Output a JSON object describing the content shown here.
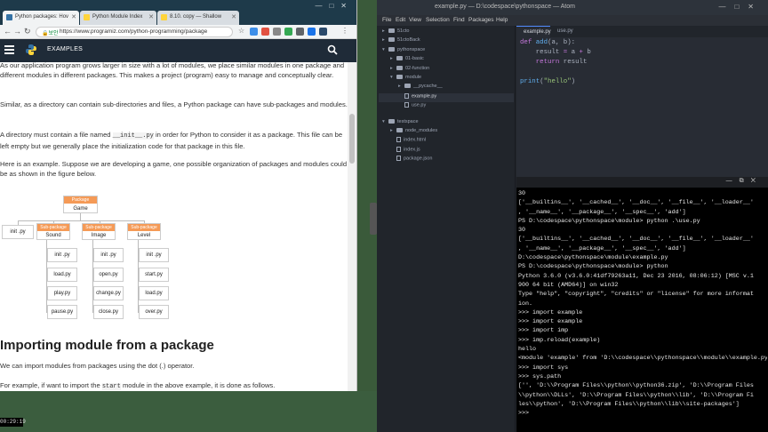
{
  "chrome": {
    "tabs": [
      {
        "label": "Python packages: Hov"
      },
      {
        "label": "Python Module Index"
      },
      {
        "label": "8.10. copy — Shallow"
      }
    ],
    "url_secure": "보안",
    "url": "https://www.programiz.com/python-programming/package",
    "site": {
      "nav_label": "EXAMPLES"
    },
    "content": {
      "p1": "As our application program grows larger in size with a lot of modules, we place similar modules in one package and different modules in different packages. This makes a project (program) easy to manage and conceptually clear.",
      "p2": "Similar, as a directory can contain sub-directories and files, a Python package can have sub-packages and modules.",
      "p3_a": "A directory must contain a file named",
      "p3_code": "__init__.py",
      "p3_b": "in order for Python to consider it as a package. This file can be left empty but we generally place the initialization code for that package in this file.",
      "p4": "Here is an example. Suppose we are developing a game, one possible organization of packages and modules could be as shown in the figure below.",
      "heading": "Importing module from a package",
      "p5": "We can import modules from packages using the dot (.) operator.",
      "p6_a": "For example, if want to import the",
      "p6_code": "start",
      "p6_b": "module in the above example, it is done as follows."
    },
    "diagram": {
      "package_tag": "Package",
      "package_name": "Game",
      "subpackage_tag": "Sub-package",
      "root_init": "init  .py",
      "subpackages": [
        {
          "name": "Sound",
          "files": [
            "init  .py",
            "load.py",
            "play.py",
            "pause.py"
          ]
        },
        {
          "name": "Image",
          "files": [
            "init  .py",
            "open.py",
            "change.py",
            "close.py"
          ]
        },
        {
          "name": "Level",
          "files": [
            "init  .py",
            "start.py",
            "load.py",
            "over.py"
          ]
        }
      ]
    }
  },
  "atom": {
    "title": "example.py — D:\\codespace\\pythonspace — Atom",
    "menu": [
      "File",
      "Edit",
      "View",
      "Selection",
      "Find",
      "Packages",
      "Help"
    ],
    "tree": [
      {
        "label": "51cto",
        "depth": 0,
        "type": "folder",
        "open": false
      },
      {
        "label": "51ctoBack",
        "depth": 0,
        "type": "folder",
        "open": false
      },
      {
        "label": "pythonspace",
        "depth": 0,
        "type": "folder",
        "open": true
      },
      {
        "label": "01-basic",
        "depth": 1,
        "type": "folder",
        "open": false
      },
      {
        "label": "02-function",
        "depth": 1,
        "type": "folder",
        "open": false
      },
      {
        "label": "module",
        "depth": 1,
        "type": "folder",
        "open": true
      },
      {
        "label": "__pycache__",
        "depth": 2,
        "type": "folder",
        "open": false
      },
      {
        "label": "example.py",
        "depth": 2,
        "type": "file",
        "selected": true
      },
      {
        "label": "use.py",
        "depth": 2,
        "type": "file"
      },
      {
        "label": "testspace",
        "depth": 0,
        "type": "folder",
        "open": true
      },
      {
        "label": "node_modules",
        "depth": 1,
        "type": "folder",
        "open": false
      },
      {
        "label": "index.html",
        "depth": 1,
        "type": "file"
      },
      {
        "label": "index.js",
        "depth": 1,
        "type": "file"
      },
      {
        "label": "package.json",
        "depth": 1,
        "type": "file"
      }
    ],
    "editor_tabs": [
      "example.py",
      "use.py"
    ],
    "code": [
      "def add(a, b):",
      "    result = a + b",
      "    return result",
      "",
      "",
      "print(\"hello\")"
    ],
    "terminal": [
      "30",
      "['__builtins__', '__cached__', '__doc__', '__file__', '__loader__'",
      ", '__name__', '__package__', '__spec__', 'add']",
      "PS D:\\codespace\\pythonspace\\module> python .\\use.py",
      "30",
      "['__builtins__', '__cached__', '__doc__', '__file__', '__loader__'",
      ", '__name__', '__package__', '__spec__', 'add']",
      "D:\\codespace\\pythonspace\\module\\example.py",
      "PS D:\\codespace\\pythonspace\\module> python",
      "Python 3.6.0 (v3.6.0:41df79263a11, Dec 23 2016, 08:06:12) [MSC v.1",
      "900 64 bit (AMD64)] on win32",
      "Type \"help\", \"copyright\", \"credits\" or \"license\" for more informat",
      "ion.",
      ">>> import example",
      ">>> import example",
      ">>> import imp",
      ">>> imp.reload(example)",
      "hello",
      "<module 'example' from 'D:\\\\codespace\\\\pythonspace\\\\module\\\\example.py'>",
      ">>> import sys",
      ">>> sys.path",
      "['', 'D:\\\\Program Files\\\\python\\\\python36.zip', 'D:\\\\Program Files",
      "\\\\python\\\\DLLs', 'D:\\\\Program Files\\\\python\\\\lib', 'D:\\\\Program Fi",
      "les\\\\python', 'D:\\\\Program Files\\\\python\\\\lib\\\\site-packages']",
      ">>>"
    ]
  },
  "recording_timer": "00:29:19"
}
